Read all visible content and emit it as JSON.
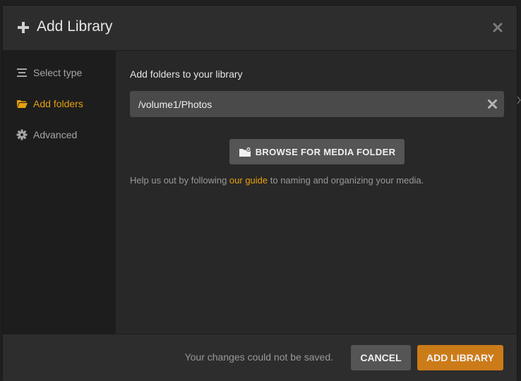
{
  "dialog": {
    "title": "Add Library",
    "plus_icon": "plus-icon",
    "close_icon": "close-icon"
  },
  "sidebar": {
    "items": [
      {
        "label": "Select type",
        "icon": "list-icon",
        "active": false
      },
      {
        "label": "Add folders",
        "icon": "folder-open-icon",
        "active": true
      },
      {
        "label": "Advanced",
        "icon": "gear-icon",
        "active": false
      }
    ]
  },
  "main": {
    "section_label": "Add folders to your library",
    "folder_path": "/volume1/Photos",
    "browse_button": "BROWSE FOR MEDIA FOLDER",
    "help_prefix": "Help us out by following ",
    "help_link": "our guide",
    "help_suffix": " to naming and organizing your media."
  },
  "footer": {
    "status": "Your changes could not be saved.",
    "cancel_label": "CANCEL",
    "add_label": "ADD LIBRARY"
  },
  "colors": {
    "accent": "#e5a00d",
    "primary_button": "#cc7b19",
    "background": "#282828",
    "sidebar": "#1d1d1d"
  }
}
